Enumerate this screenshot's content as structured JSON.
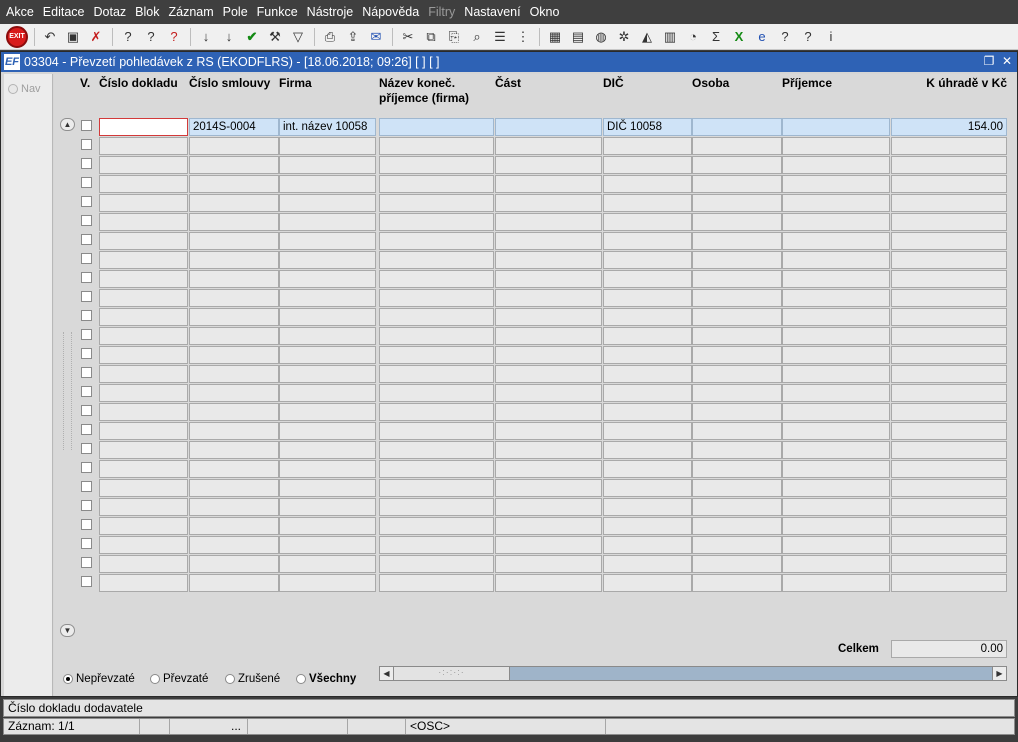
{
  "menu": [
    "Akce",
    "Editace",
    "Dotaz",
    "Blok",
    "Záznam",
    "Pole",
    "Funkce",
    "Nástroje",
    "Nápověda",
    "Filtry",
    "Nastavení",
    "Okno"
  ],
  "menu_disabled": [
    "Filtry"
  ],
  "toolbar": {
    "exit_label": "EXIT",
    "icons": [
      "exit-icon",
      "undo-icon",
      "save-icon",
      "delete-record-icon",
      "enter-query-icon",
      "execute-query-icon",
      "cancel-query-icon",
      "sort-asc-icon",
      "sort-desc-icon",
      "confirm-icon",
      "tools-icon",
      "filter-icon",
      "print-icon",
      "export-icon",
      "mail-icon",
      "cut-icon",
      "copy-icon",
      "paste-icon",
      "search-icon",
      "list-icon",
      "tree-icon",
      "calculator-icon",
      "document-icon",
      "globe-icon",
      "settings-icon",
      "chart-icon",
      "report-icon",
      "clock-icon",
      "sum-icon",
      "excel-icon",
      "ie-icon",
      "help-icon",
      "context-help-icon",
      "info-icon"
    ]
  },
  "window": {
    "title": "03304 - Převzetí pohledávek z RS (EKODFLRS) - [18.06.2018; 09:26]  [ ]  [ ]",
    "app_icon": "EF"
  },
  "left_panel": {
    "nav_label": "Nav"
  },
  "columns": [
    {
      "label": "V."
    },
    {
      "label": "Číslo dokladu"
    },
    {
      "label": "Číslo smlouvy"
    },
    {
      "label": "Firma"
    },
    {
      "label": "Název koneč.\npříjemce (firma)"
    },
    {
      "label": "Část"
    },
    {
      "label": "DIČ"
    },
    {
      "label": "Osoba"
    },
    {
      "label": "Příjemce"
    },
    {
      "label": "K úhradě v Kč"
    }
  ],
  "rows": [
    {
      "cislo_dokladu": "",
      "cislo_smlouvy": "2014S-0004",
      "firma": "int. název 10058",
      "nazev": "",
      "cast": "",
      "dic": "DIČ 10058",
      "osoba": "",
      "prijemce": "",
      "k_uhrade": "154.00"
    }
  ],
  "empty_row_count": 24,
  "total": {
    "label": "Celkem",
    "value": "0.00"
  },
  "filters": [
    {
      "label": "Nepřevzaté",
      "checked": true
    },
    {
      "label": "Převzaté",
      "checked": false
    },
    {
      "label": "Zrušené",
      "checked": false
    },
    {
      "label": "Všechny",
      "checked": false
    }
  ],
  "status": {
    "hint": "Číslo dokladu dodavatele",
    "record": "Záznam: 1/1",
    "ellipsis": "...",
    "mode": "<OSC>"
  },
  "colors": {
    "title_bar": "#2e62b5",
    "selected_row": "#cfe3f7",
    "focus_border": "#d23a3a"
  }
}
